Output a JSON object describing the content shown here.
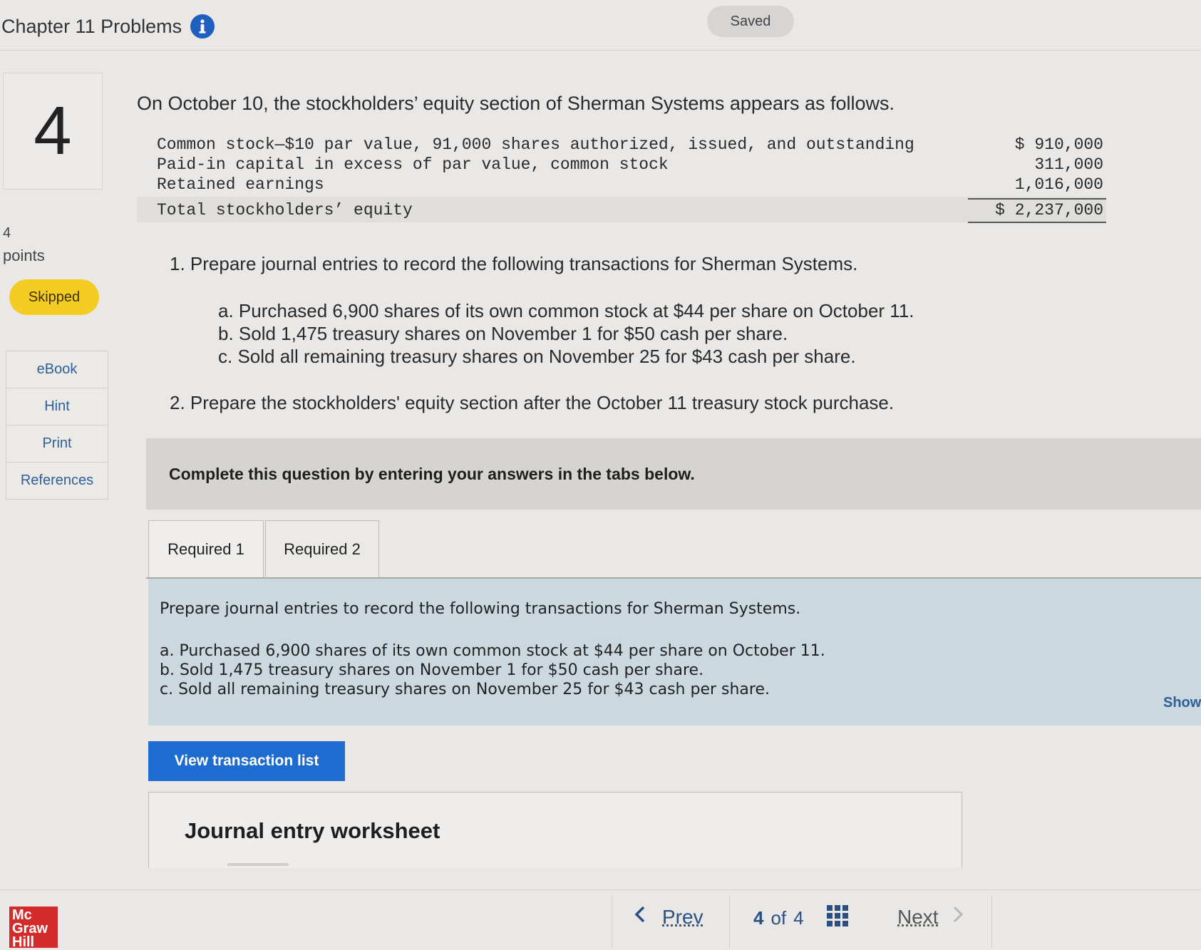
{
  "header": {
    "title": "Chapter 11 Problems",
    "saved": "Saved"
  },
  "question": {
    "number": "4",
    "points_value": "4",
    "points_label": "points",
    "status": "Skipped"
  },
  "sidebar": {
    "items": [
      {
        "label": "eBook"
      },
      {
        "label": "Hint"
      },
      {
        "label": "Print"
      },
      {
        "label": "References"
      }
    ]
  },
  "problem": {
    "intro": "On October 10, the stockholders’ equity section of Sherman Systems appears as follows.",
    "equity": [
      {
        "label": "Common stock—$10 par value, 91,000 shares authorized, issued, and outstanding",
        "amount": "$ 910,000"
      },
      {
        "label": "Paid-in capital in excess of par value, common stock",
        "amount": "311,000"
      },
      {
        "label": "Retained earnings",
        "amount": "1,016,000"
      }
    ],
    "total": {
      "label": "Total stockholders’ equity",
      "amount": "$ 2,237,000"
    },
    "task1": "1. Prepare journal entries to record the following transactions for Sherman Systems.",
    "transactions": [
      "a. Purchased 6,900 shares of its own common stock at $44 per share on October 11.",
      "b. Sold 1,475 treasury shares on November 1 for $50 cash per share.",
      "c. Sold all remaining treasury shares on November 25 for $43 cash per share."
    ],
    "task2": "2. Prepare the stockholders' equity section after the October 11 treasury stock purchase."
  },
  "answer_area": {
    "banner": "Complete this question by entering your answers in the tabs below.",
    "tabs": [
      {
        "label": "Required 1"
      },
      {
        "label": "Required 2"
      }
    ],
    "panel_intro": "Prepare journal entries to record the following transactions for Sherman Systems.",
    "panel_items": [
      "a. Purchased 6,900 shares of its own common stock at $44 per share on October 11.",
      "b. Sold 1,475 treasury shares on November 1 for $50 cash per share.",
      "c. Sold all remaining treasury shares on November 25 for $43 cash per share."
    ],
    "show_text": "Show",
    "view_button": "View transaction list",
    "worksheet_title": "Journal entry worksheet"
  },
  "footer": {
    "logo": [
      "Mc",
      "Graw",
      "Hill"
    ],
    "prev": "Prev",
    "page_current": "4",
    "page_of": "of",
    "page_total": "4",
    "next": "Next"
  },
  "colors": {
    "accent": "#1e6ccf",
    "skipped": "#f3cc24",
    "panel": "#cbd8e0",
    "link": "#2e5f99"
  }
}
